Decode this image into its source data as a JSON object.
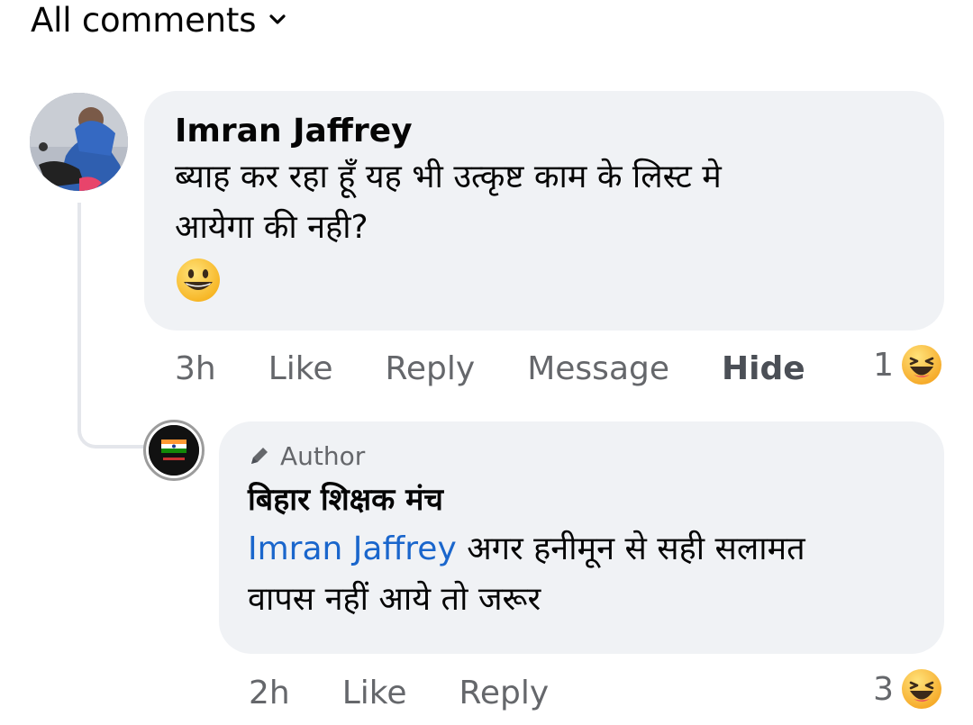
{
  "header": {
    "title": "All comments"
  },
  "comments": [
    {
      "author": "Imran Jaffrey",
      "text_line1": "ब्याह कर रहा हूँ यह भी उत्कृष्ट काम के लिस्ट मे",
      "text_line2": "आयेगा की नही?",
      "emoji": "grinning-face",
      "time": "3h",
      "actions": [
        "Like",
        "Reply",
        "Message",
        "Hide"
      ],
      "reaction_count": "1",
      "reaction_icon": "laughing-face-icon"
    },
    {
      "badge": "Author",
      "author": "बिहार शिक्षक मंच",
      "mention": "Imran Jaffrey",
      "text_line1": " अगर हनीमून से सही सलामत",
      "text_line2": "वापस नहीं आये तो जरूर",
      "time": "2h",
      "actions": [
        "Like",
        "Reply"
      ],
      "reaction_count": "3",
      "reaction_icon": "laughing-face-icon"
    }
  ],
  "colors": {
    "bubble": "#f0f2f5",
    "secondary_text": "#65676b",
    "mention": "#1a66cc"
  }
}
